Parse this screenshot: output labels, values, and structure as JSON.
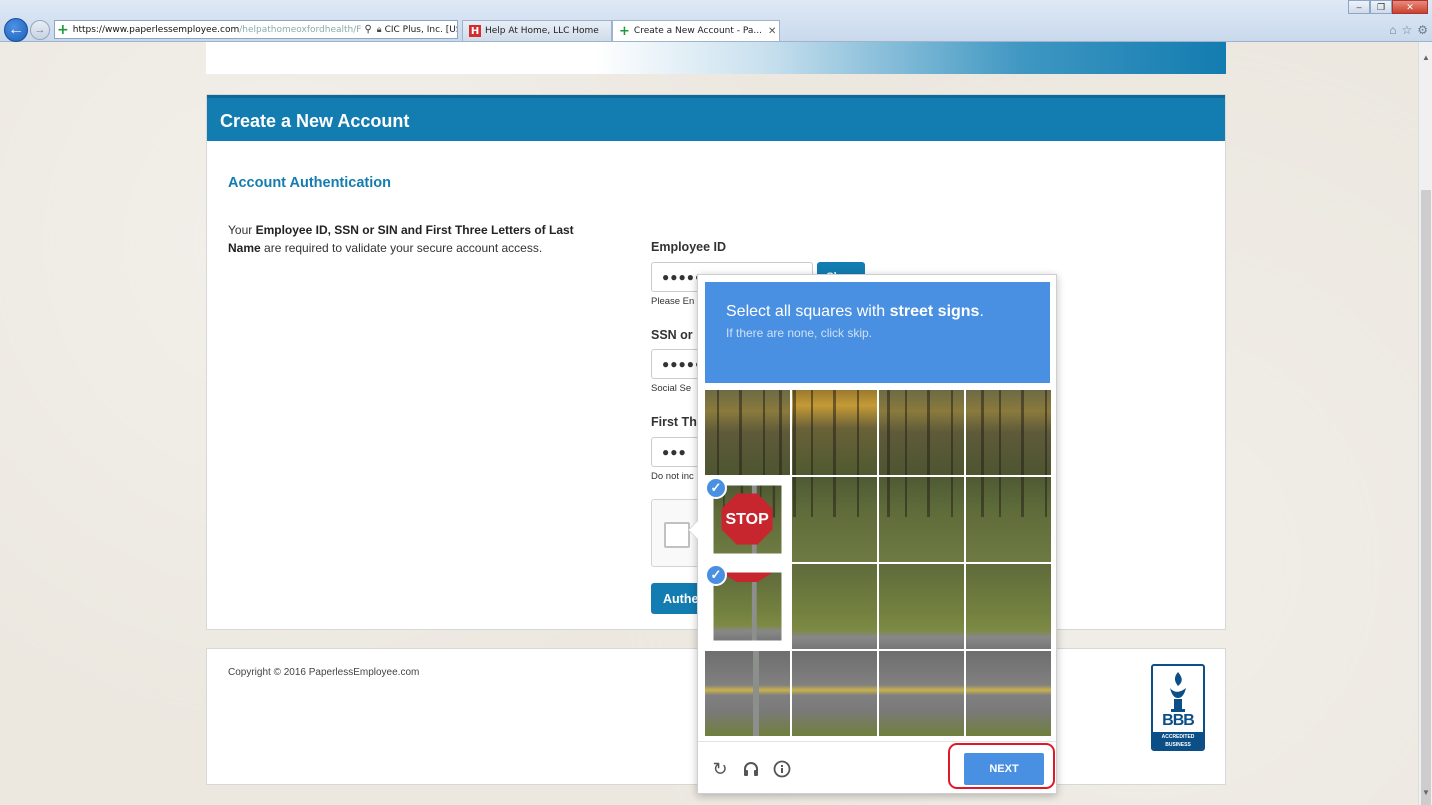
{
  "browser": {
    "url_host": "https://www.paperlessemployee.com",
    "url_path": "/helpathomeoxfordhealth/F",
    "cert_label": "CIC Plus, Inc. [US]",
    "tabs": [
      {
        "label": "Help At Home, LLC Home",
        "active": false
      },
      {
        "label": "Create a New Account - Pa...",
        "active": true
      }
    ]
  },
  "page": {
    "card_title": "Create a New Account",
    "section_title": "Account Authentication",
    "intro": {
      "t1": "Your ",
      "b1": "Employee ID, SSN or SIN and First Three Letters of Last Name",
      "t2": " are required to validate your secure account access."
    },
    "fields": {
      "employee_id": {
        "label": "Employee ID",
        "value": "●●●●●●●●●●●●",
        "hint": "Please En"
      },
      "ssn": {
        "label": "SSN or",
        "value": "●●●●●",
        "hint": "Social Se"
      },
      "first_three": {
        "label": "First Th",
        "value": "●●●",
        "hint": "Do not inc"
      }
    },
    "show_label": "Show",
    "auth_label": "Authe",
    "copyright": "Copyright © 2016 PaperlessEmployee.com",
    "bbb": {
      "logo": "BBB",
      "badge": "ACCREDITED BUSINESS"
    }
  },
  "captcha": {
    "prompt_prefix": "Select all squares with ",
    "prompt_target": "street signs",
    "prompt_suffix": ".",
    "subtitle": "If there are none, click skip.",
    "selected_tiles": [
      4,
      8
    ],
    "tile_stop_text": "STOP",
    "next_label": "NEXT",
    "accent": "#4a90e2"
  }
}
